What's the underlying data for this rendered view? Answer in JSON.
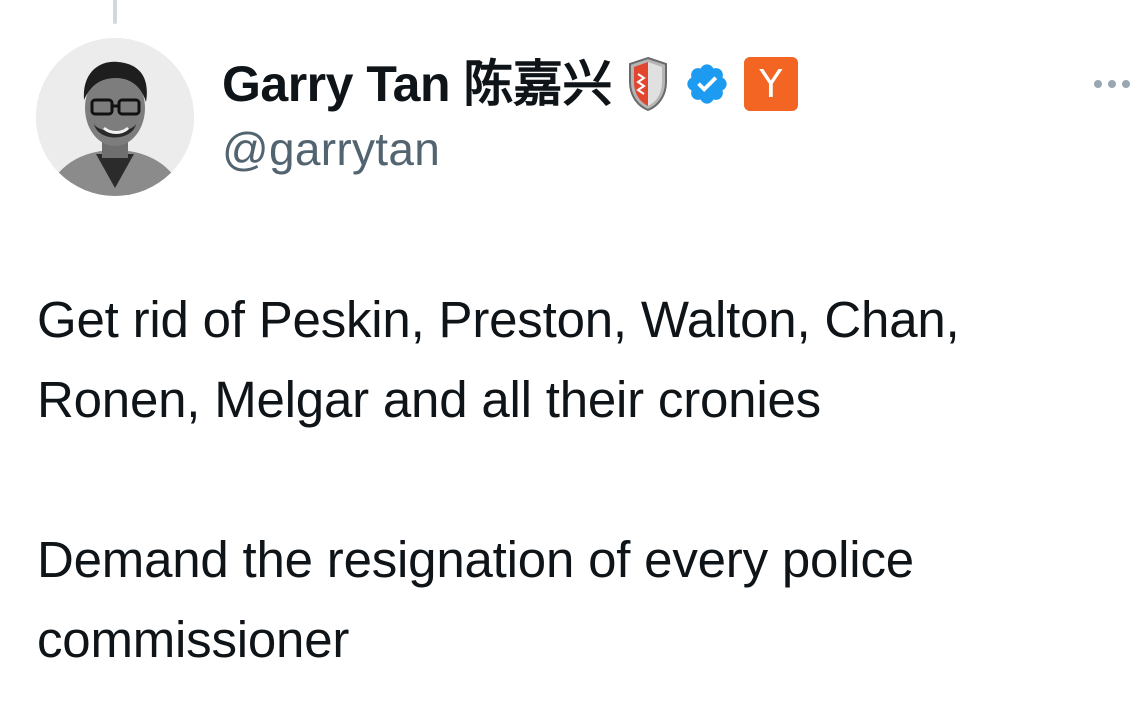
{
  "thread": {
    "connector": true
  },
  "author": {
    "display_name": "Garry Tan 陈嘉兴",
    "handle": "@garrytan",
    "badges": [
      "shield-emoji",
      "verified-check",
      "ycombinator-logo"
    ],
    "verified_color": "#1d9bf0",
    "yc_color": "#f26522",
    "yc_letter": "Y"
  },
  "tweet": {
    "lines_para1": [
      "Get rid of Peskin, Preston, Walton, Chan,",
      "Ronen, Melgar and all their cronies"
    ],
    "lines_para2": [
      "Demand the resignation of every police",
      "commissioner"
    ]
  },
  "icons": {
    "more": "more-options-icon"
  }
}
